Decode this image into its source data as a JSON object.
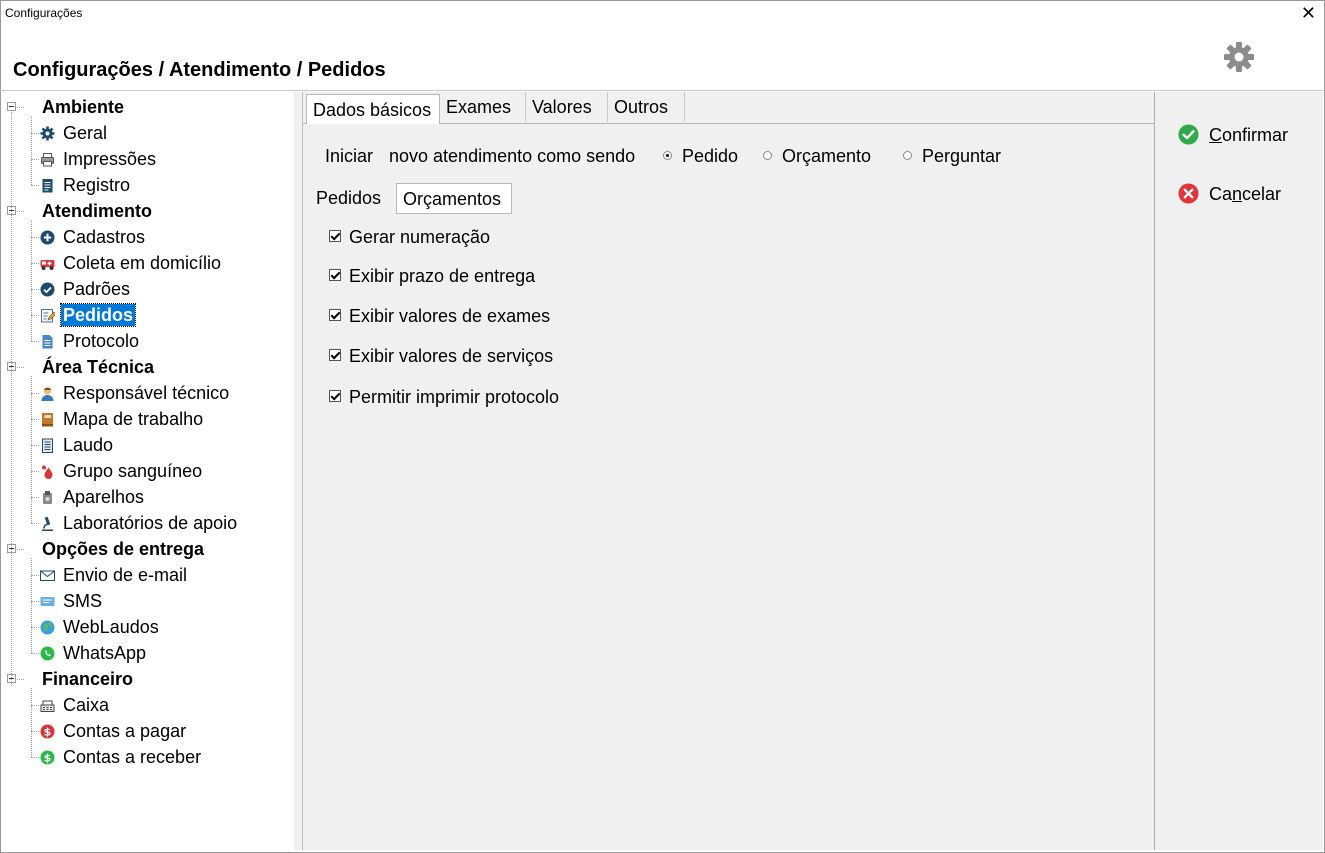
{
  "window": {
    "title": "Configurações",
    "close_glyph": "✕"
  },
  "page_title": "Configurações / Atendimento / Pedidos",
  "header_icon": "gear-icon",
  "tree": {
    "groups": [
      {
        "label": "Ambiente",
        "items": [
          {
            "label": "Geral",
            "icon": "gear-icon"
          },
          {
            "label": "Impressões",
            "icon": "printer-icon"
          },
          {
            "label": "Registro",
            "icon": "document-icon"
          }
        ]
      },
      {
        "label": "Atendimento",
        "items": [
          {
            "label": "Cadastros",
            "icon": "plus-circle-icon"
          },
          {
            "label": "Coleta em domicílio",
            "icon": "ambulance-icon"
          },
          {
            "label": "Padrões",
            "icon": "check-circle-icon"
          },
          {
            "label": "Pedidos",
            "icon": "edit-document-icon",
            "selected": true
          },
          {
            "label": "Protocolo",
            "icon": "file-icon"
          }
        ]
      },
      {
        "label": "Área Técnica",
        "items": [
          {
            "label": "Responsável técnico",
            "icon": "person-icon"
          },
          {
            "label": "Mapa de trabalho",
            "icon": "book-icon"
          },
          {
            "label": "Laudo",
            "icon": "report-icon"
          },
          {
            "label": "Grupo sanguíneo",
            "icon": "blood-drop-icon"
          },
          {
            "label": "Aparelhos",
            "icon": "device-icon"
          },
          {
            "label": "Laboratórios de apoio",
            "icon": "microscope-icon"
          }
        ]
      },
      {
        "label": "Opções de entrega",
        "items": [
          {
            "label": "Envio de e-mail",
            "icon": "envelope-icon"
          },
          {
            "label": "SMS",
            "icon": "sms-icon"
          },
          {
            "label": "WebLaudos",
            "icon": "globe-icon"
          },
          {
            "label": "WhatsApp",
            "icon": "whatsapp-icon"
          }
        ]
      },
      {
        "label": "Financeiro",
        "items": [
          {
            "label": "Caixa",
            "icon": "cash-register-icon"
          },
          {
            "label": "Contas a pagar",
            "icon": "dollar-red-icon"
          },
          {
            "label": "Contas a receber",
            "icon": "dollar-green-icon"
          }
        ]
      }
    ]
  },
  "tabs": [
    {
      "label": "Dados básicos",
      "active": true
    },
    {
      "label": "Exames"
    },
    {
      "label": "Valores"
    },
    {
      "label": "Outros"
    }
  ],
  "start_option": {
    "label_iniciar": "Iniciar",
    "label_text": "novo atendimento como sendo",
    "options": [
      {
        "label": "Pedido",
        "selected": true
      },
      {
        "label": "Orçamento",
        "selected": false
      },
      {
        "label": "Perguntar",
        "selected": false
      }
    ]
  },
  "subtabs": [
    {
      "label": "Pedidos"
    },
    {
      "label": "Orçamentos",
      "active": true
    }
  ],
  "checkboxes": [
    {
      "label": "Gerar numeração",
      "checked": true
    },
    {
      "label": "Exibir prazo de entrega",
      "checked": true
    },
    {
      "label": "Exibir valores de exames",
      "checked": true
    },
    {
      "label": "Exibir valores de serviços",
      "checked": true
    },
    {
      "label": "Permitir imprimir protocolo",
      "checked": true
    }
  ],
  "actions": {
    "confirm": {
      "underline": "C",
      "rest": "onfirmar",
      "icon": "check-circle-green-icon",
      "color": "#2eaa4a"
    },
    "cancel": {
      "pre": "Ca",
      "underline": "n",
      "rest": "celar",
      "icon": "x-circle-red-icon",
      "color": "#e0353a"
    }
  }
}
